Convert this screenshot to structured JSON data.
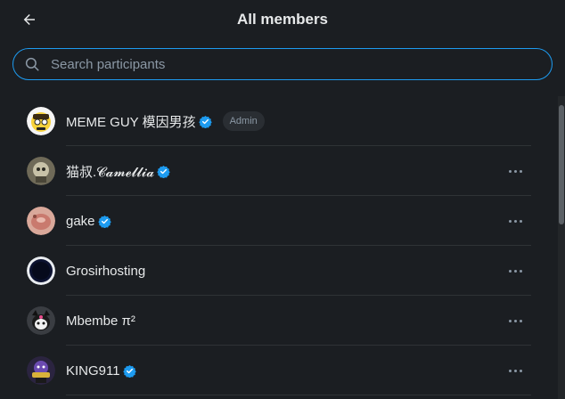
{
  "header": {
    "title": "All members"
  },
  "search": {
    "placeholder": "Search participants"
  },
  "members": [
    {
      "name": "MEME GUY 模因男孩",
      "verified": true,
      "badge": "Admin",
      "more": false
    },
    {
      "name": "猫叔.𝓒𝓪𝓶𝓮𝓵𝓵𝓲𝓪",
      "verified": true,
      "badge": "",
      "more": true
    },
    {
      "name": "gake",
      "verified": true,
      "badge": "",
      "more": true
    },
    {
      "name": "Grosirhosting",
      "verified": false,
      "badge": "",
      "more": true
    },
    {
      "name": "Mbembe π²",
      "verified": false,
      "badge": "",
      "more": true
    },
    {
      "name": "KING911",
      "verified": true,
      "badge": "",
      "more": true
    }
  ],
  "colors": {
    "accent": "#1d9bf0",
    "background": "#1b1e22",
    "text": "#e7e9ea",
    "muted": "#8b98a5"
  },
  "icons": {
    "back": "arrow-left-icon",
    "search": "search-icon",
    "verified": "verified-badge-icon",
    "more": "more-horizontal-icon"
  }
}
